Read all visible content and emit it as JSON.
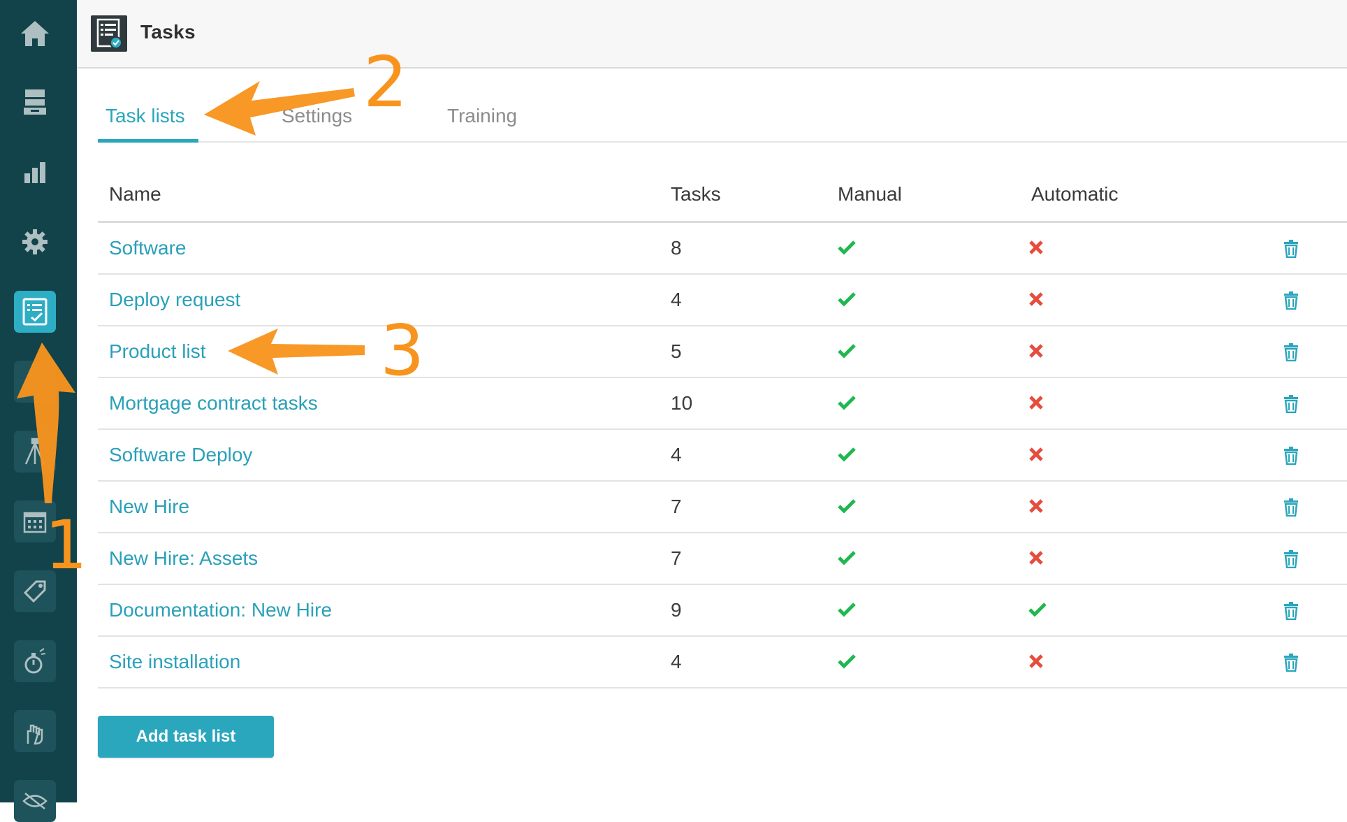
{
  "app": {
    "title": "Tasks"
  },
  "tabs": [
    {
      "label": "Task lists",
      "active": true
    },
    {
      "label": "Settings",
      "active": false
    },
    {
      "label": "Training",
      "active": false
    }
  ],
  "table": {
    "headers": {
      "name": "Name",
      "tasks": "Tasks",
      "manual": "Manual",
      "automatic": "Automatic"
    },
    "rows": [
      {
        "name": "Software",
        "tasks": "8",
        "manual": true,
        "automatic": false
      },
      {
        "name": "Deploy request",
        "tasks": "4",
        "manual": true,
        "automatic": false
      },
      {
        "name": "Product list",
        "tasks": "5",
        "manual": true,
        "automatic": false
      },
      {
        "name": "Mortgage contract tasks",
        "tasks": "10",
        "manual": true,
        "automatic": false
      },
      {
        "name": "Software Deploy",
        "tasks": "4",
        "manual": true,
        "automatic": false
      },
      {
        "name": "New Hire",
        "tasks": "7",
        "manual": true,
        "automatic": false
      },
      {
        "name": "New Hire: Assets",
        "tasks": "7",
        "manual": true,
        "automatic": false
      },
      {
        "name": "Documentation: New Hire",
        "tasks": "9",
        "manual": true,
        "automatic": true
      },
      {
        "name": "Site installation",
        "tasks": "4",
        "manual": true,
        "automatic": false
      }
    ]
  },
  "actions": {
    "add_label": "Add task list"
  },
  "annotations": {
    "one": "1",
    "two": "2",
    "three": "3"
  },
  "sidebar": {
    "items": [
      {
        "icon": "home-icon"
      },
      {
        "icon": "inbox-tray-icon"
      },
      {
        "icon": "bar-chart-icon"
      },
      {
        "icon": "gear-icon"
      },
      {
        "icon": "task-checklist-icon",
        "active": true
      },
      {
        "icon": "blank-icon"
      },
      {
        "icon": "tripod-icon"
      },
      {
        "icon": "calendar-icon"
      },
      {
        "icon": "tag-icon"
      },
      {
        "icon": "stopwatch-icon"
      },
      {
        "icon": "hand-icon"
      },
      {
        "icon": "eye-slash-icon"
      }
    ]
  },
  "colors": {
    "sidebar": "#12424a",
    "accent": "#2aa6bd",
    "check": "#1fb84f",
    "cross": "#e74c3c",
    "annotation": "#f8941e"
  }
}
